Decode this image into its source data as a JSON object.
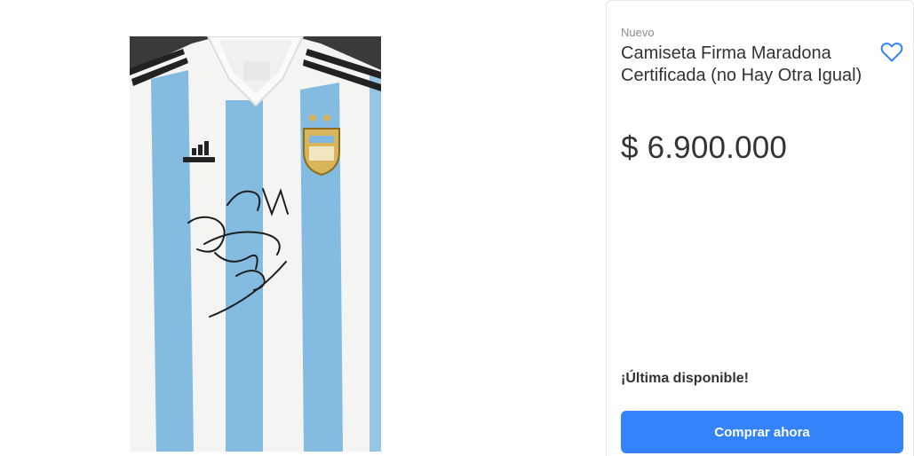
{
  "product": {
    "condition": "Nuevo",
    "title": "Camiseta Firma Maradona Certificada (no Hay Otra Igual)",
    "price": "$ 6.900.000",
    "stock_label": "¡Última disponible!",
    "buy_label": "Comprar ahora",
    "favorite_icon": "heart-outline-icon"
  },
  "image": {
    "subject": "Argentina football shirt signed by Maradona",
    "shirt_brand_logo": "adidas",
    "crest_text": "AFA",
    "signature_text": "Diego"
  },
  "colors": {
    "accent": "#3483fa",
    "heart": "#3483fa",
    "shirt_blue": "#6fb0de",
    "shirt_white": "#f4f4f2"
  }
}
